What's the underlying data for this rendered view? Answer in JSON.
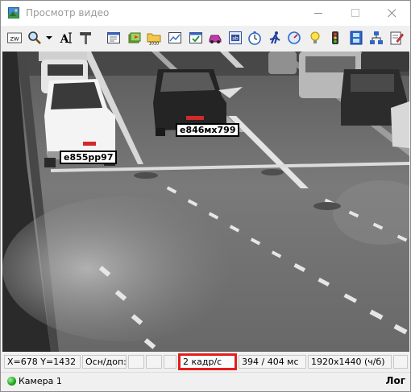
{
  "window": {
    "title": "Просмотр видео",
    "icons": {
      "app": "picture-icon",
      "minimize": "minimize-icon",
      "maximize": "maximize-icon",
      "close": "close-icon"
    }
  },
  "toolbar": {
    "tools": [
      {
        "name": "tool-keyboard",
        "icon": "keyboard-icon",
        "label": "ZW"
      },
      {
        "name": "tool-zoom",
        "icon": "magnifier-icon"
      },
      {
        "name": "tool-zoom-dropdown",
        "icon": "dropdown-arrow-icon"
      },
      {
        "name": "tool-text",
        "icon": "text-style-icon",
        "label": "A"
      },
      {
        "name": "tool-settings",
        "icon": "tools-icon"
      },
      {
        "name": "tool-properties",
        "icon": "window-list-icon"
      },
      {
        "name": "tool-export",
        "icon": "book-export-icon"
      },
      {
        "name": "tool-folder",
        "icon": "folder-numbers-icon"
      },
      {
        "name": "tool-chart",
        "icon": "chart-window-icon"
      },
      {
        "name": "tool-detect",
        "icon": "window-check-icon"
      },
      {
        "name": "tool-vehicle",
        "icon": "car-icon"
      },
      {
        "name": "tool-form",
        "icon": "form-icon"
      },
      {
        "name": "tool-timer",
        "icon": "stopwatch-icon"
      },
      {
        "name": "tool-pedestrian",
        "icon": "running-man-icon"
      },
      {
        "name": "tool-speed",
        "icon": "speed-dial-icon"
      },
      {
        "name": "tool-light",
        "icon": "light-bulb-icon"
      },
      {
        "name": "tool-traffic-light",
        "icon": "traffic-light-icon"
      },
      {
        "name": "tool-film",
        "icon": "film-icon"
      },
      {
        "name": "tool-network",
        "icon": "network-icon"
      },
      {
        "name": "tool-edit",
        "icon": "edit-document-icon"
      }
    ]
  },
  "video": {
    "plates": [
      {
        "text": "e855рр97"
      },
      {
        "text": "e846мх799"
      }
    ]
  },
  "status": {
    "coords": "X=678 Y=1432",
    "osn_label": "Осн/доп:",
    "fps": "2 кадр/с",
    "timing": "394 / 404 мс",
    "resolution": "1920х1440 (ч/б)"
  },
  "camera": {
    "label": "Камера 1",
    "log": "Лог"
  },
  "colors": {
    "highlight": "#e31d1d",
    "camera_status": "#1ea31a"
  }
}
